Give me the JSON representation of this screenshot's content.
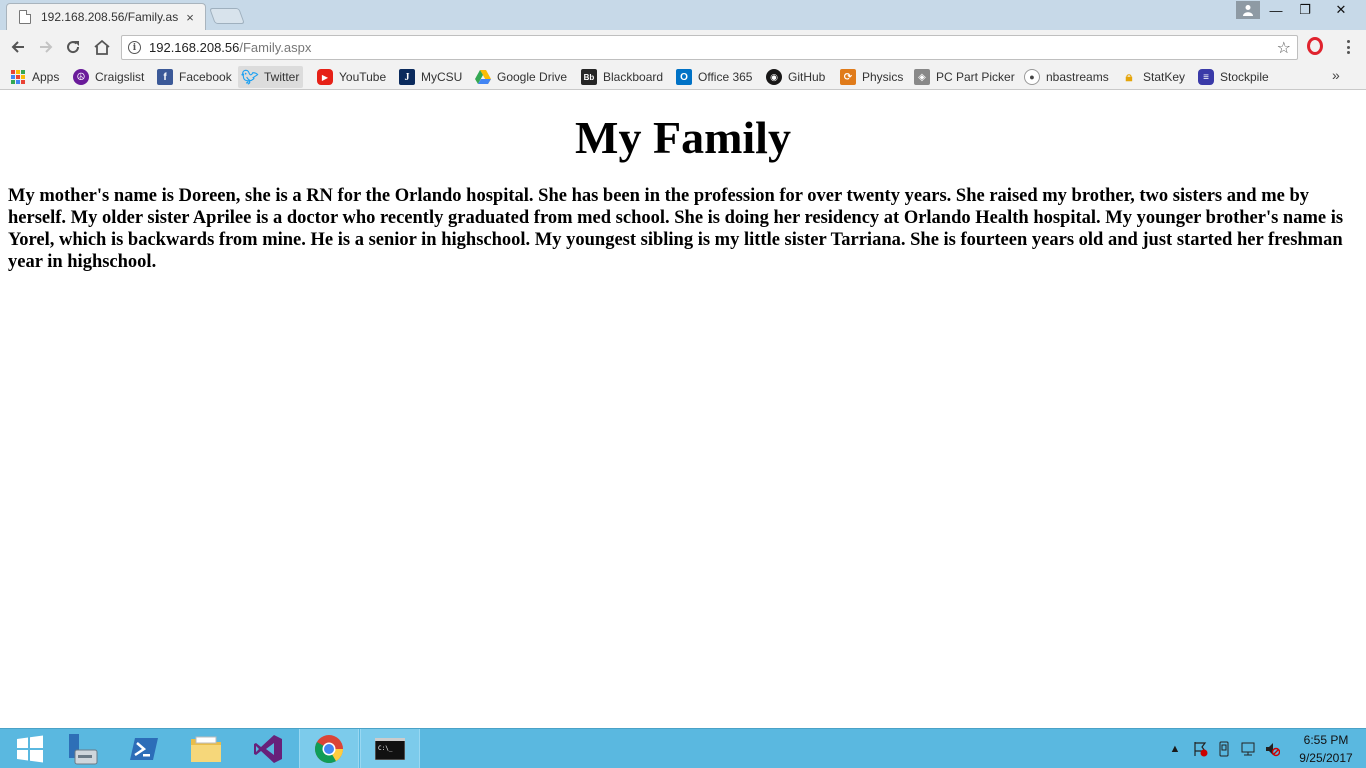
{
  "browser": {
    "tab_title": "192.168.208.56/Family.as",
    "tab_close": "×",
    "url_host": "192.168.208.56",
    "url_path": "/Family.aspx",
    "profile_icon": "person-icon",
    "min_label": "—",
    "max_label": "❐",
    "close_label": "✕"
  },
  "bookmarks": [
    {
      "label": "Apps",
      "icon": "apps-grid-icon"
    },
    {
      "label": "Craigslist",
      "icon": "peace-icon",
      "color": "#6a1b9a"
    },
    {
      "label": "Facebook",
      "icon": "facebook-icon",
      "color": "#3b5998"
    },
    {
      "label": "Twitter",
      "icon": "twitter-icon",
      "color": "#1da1f2"
    },
    {
      "label": "YouTube",
      "icon": "youtube-icon",
      "color": "#e62117"
    },
    {
      "label": "MyCSU",
      "icon": "mycsu-icon",
      "color": "#0a2a5c"
    },
    {
      "label": "Google Drive",
      "icon": "google-drive-icon"
    },
    {
      "label": "Blackboard",
      "icon": "blackboard-icon",
      "color": "#262626"
    },
    {
      "label": "Office 365",
      "icon": "outlook-icon",
      "color": "#0072c6"
    },
    {
      "label": "GitHub",
      "icon": "github-icon",
      "color": "#181717"
    },
    {
      "label": "Physics",
      "icon": "physics-icon",
      "color": "#e07b1a"
    },
    {
      "label": "PC Part Picker",
      "icon": "pcpartpicker-icon",
      "color": "#666666"
    },
    {
      "label": "nbastreams",
      "icon": "reddit-icon",
      "color": "#ff4500"
    },
    {
      "label": "StatKey",
      "icon": "lock-icon",
      "color": "#e5a50a"
    },
    {
      "label": "Stockpile",
      "icon": "stockpile-icon",
      "color": "#3a3aa8"
    }
  ],
  "bookmarks_overflow": "»",
  "page": {
    "heading": "My Family",
    "body": "My mother's name is Doreen, she is a RN for the Orlando hospital. She has been in the profession for over twenty years. She raised my brother, two sisters and me by herself. My older sister Aprilee is a doctor who recently graduated from med school. She is doing her residency at Orlando Health hospital. My younger brother's name is Yorel, which is backwards from mine. He is a senior in highschool. My youngest sibling is my little sister Tarriana. She is fourteen years old and just started her freshman year in highschool."
  },
  "taskbar": {
    "apps": [
      "windows-start-icon",
      "server-manager-icon",
      "powershell-icon",
      "file-explorer-icon",
      "visual-studio-icon",
      "chrome-icon",
      "cmd-icon"
    ],
    "time": "6:55 PM",
    "date": "9/25/2017"
  },
  "colors": {
    "titlebar": "#c7d9e8",
    "toolbar": "#f2f2f2",
    "taskbar": "#5ab8e0"
  }
}
